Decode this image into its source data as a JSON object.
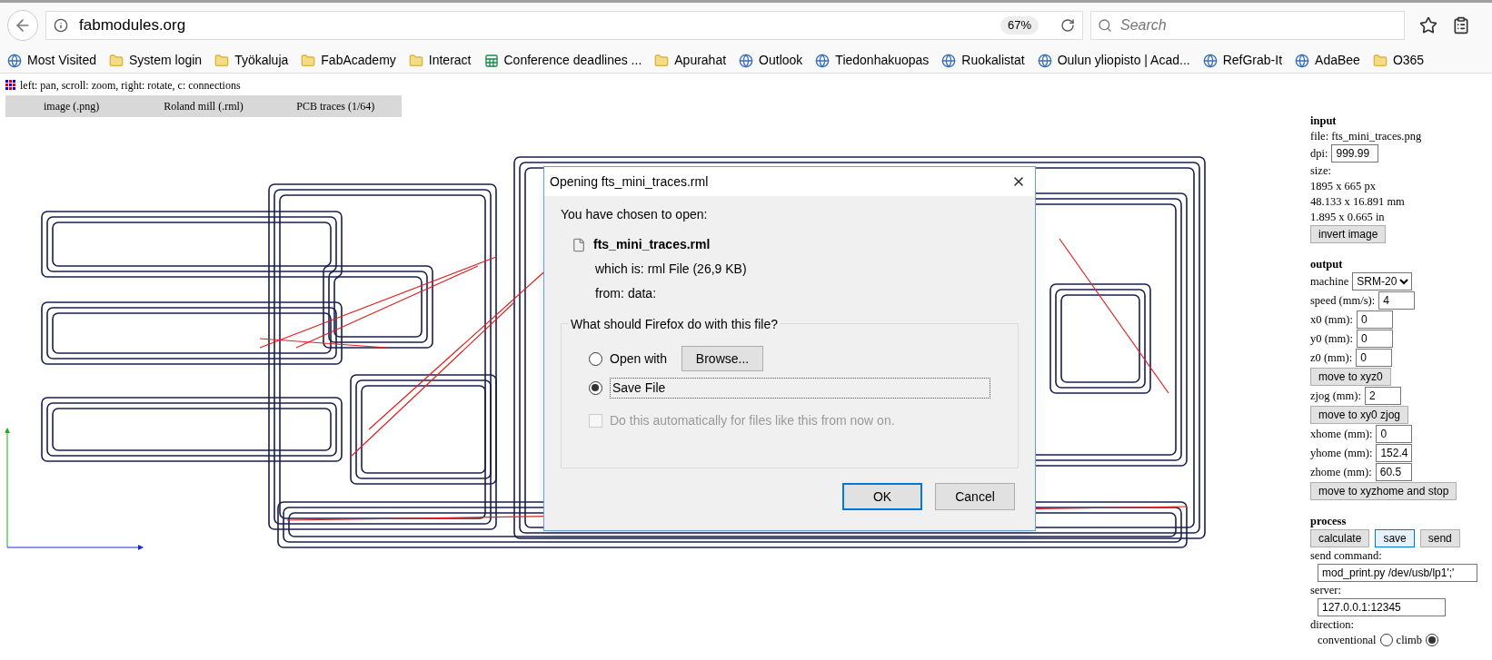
{
  "browser": {
    "url": "fabmodules.org",
    "zoom": "67%",
    "search_placeholder": "Search"
  },
  "bookmarks": [
    {
      "label": "Most Visited",
      "kind": "site"
    },
    {
      "label": "System login",
      "kind": "folder"
    },
    {
      "label": "Työkaluja",
      "kind": "folder"
    },
    {
      "label": "FabAcademy",
      "kind": "folder"
    },
    {
      "label": "Interact",
      "kind": "folder"
    },
    {
      "label": "Conference deadlines ...",
      "kind": "sheet"
    },
    {
      "label": "Apurahat",
      "kind": "folder"
    },
    {
      "label": "Outlook",
      "kind": "site"
    },
    {
      "label": "Tiedonhakuopas",
      "kind": "site"
    },
    {
      "label": "Ruokalistat",
      "kind": "site"
    },
    {
      "label": "Oulun yliopisto | Acad...",
      "kind": "site"
    },
    {
      "label": "RefGrab-It",
      "kind": "site"
    },
    {
      "label": "AdaBee",
      "kind": "site"
    },
    {
      "label": "O365",
      "kind": "folder"
    }
  ],
  "page": {
    "hint": "left: pan, scroll: zoom, right: rotate, c: connections",
    "steps": [
      "image (.png)",
      "Roland mill (.rml)",
      "PCB traces (1/64)"
    ]
  },
  "panel": {
    "input": {
      "heading": "input",
      "file": "file: fts_mini_traces.png",
      "dpi_label": "dpi:",
      "dpi": "999.99",
      "size_label": "size:",
      "sizes": [
        "1895 x 665 px",
        "48.133 x 16.891 mm",
        "1.895 x 0.665 in"
      ],
      "invert": "invert image"
    },
    "output": {
      "heading": "output",
      "machine_label": "machine",
      "machine": "SRM-20",
      "rows": [
        {
          "kind": "field",
          "label": "speed (mm/s):",
          "value": "4"
        },
        {
          "kind": "field",
          "label": "x0 (mm):",
          "value": "0"
        },
        {
          "kind": "field",
          "label": "y0 (mm):",
          "value": "0"
        },
        {
          "kind": "field",
          "label": "z0 (mm):",
          "value": "0"
        },
        {
          "kind": "button",
          "label": "move to xyz0"
        },
        {
          "kind": "field",
          "label": "zjog (mm):",
          "value": "2"
        },
        {
          "kind": "button",
          "label": "move to xy0 zjog"
        },
        {
          "kind": "field",
          "label": "xhome (mm):",
          "value": "0"
        },
        {
          "kind": "field",
          "label": "yhome (mm):",
          "value": "152.4"
        },
        {
          "kind": "field",
          "label": "zhome (mm):",
          "value": "60.5"
        },
        {
          "kind": "button",
          "label": "move to xyzhome and stop"
        }
      ]
    },
    "process": {
      "heading": "process",
      "buttons": [
        {
          "label": "calculate",
          "focused": false
        },
        {
          "label": "save",
          "focused": true
        },
        {
          "label": "send",
          "focused": false
        }
      ],
      "command_label": "send command:",
      "command": "mod_print.py /dev/usb/lp1';'",
      "server_label": "server:",
      "server": "127.0.0.1:12345",
      "direction_label": "direction:",
      "directions": [
        {
          "label": "conventional",
          "selected": false
        },
        {
          "label": "climb",
          "selected": true
        }
      ]
    }
  },
  "dialog": {
    "title": "Opening fts_mini_traces.rml",
    "intro": "You have chosen to open:",
    "filename": "fts_mini_traces.rml",
    "which_is": "which is:",
    "type": "rml File (26,9 KB)",
    "from": "from:",
    "source": "data:",
    "question": "What should Firefox do with this file?",
    "options": [
      {
        "label": "Open with",
        "selected": false
      },
      {
        "label": "Save File",
        "selected": true
      }
    ],
    "browse": "Browse...",
    "auto": {
      "label": "Do this automatically for files like this from now on.",
      "checked": false,
      "disabled": true
    },
    "buttons": [
      "OK",
      "Cancel"
    ]
  }
}
